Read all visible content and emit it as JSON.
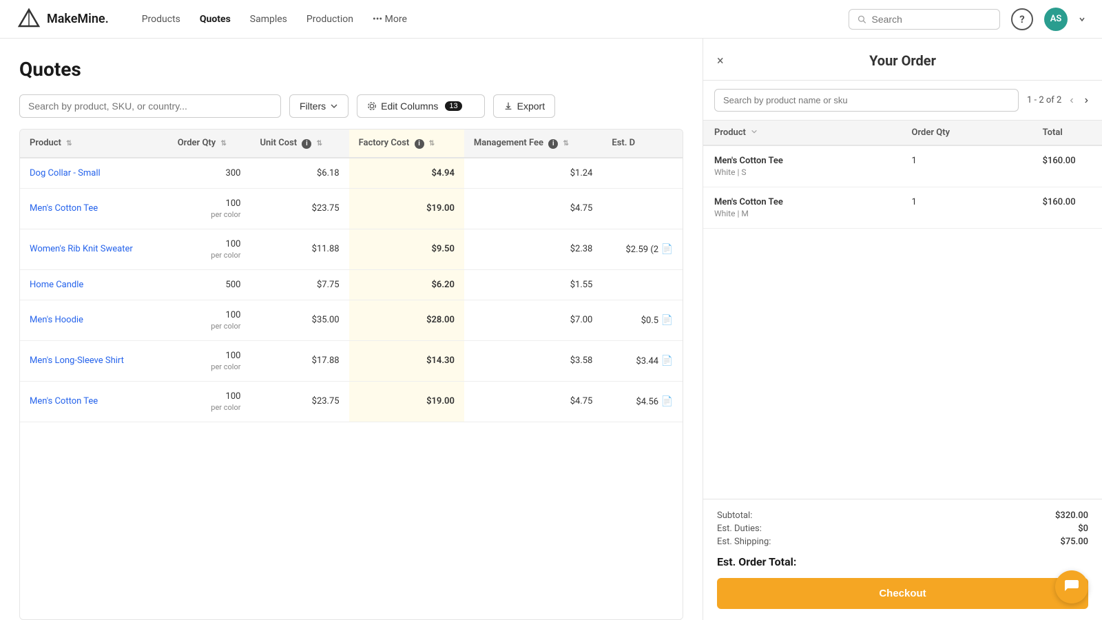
{
  "nav": {
    "logo_text": "MakeMine.",
    "links": [
      {
        "label": "Products",
        "active": false
      },
      {
        "label": "Quotes",
        "active": true
      },
      {
        "label": "Samples",
        "active": false
      },
      {
        "label": "Production",
        "active": false
      },
      {
        "label": "••• More",
        "active": false
      }
    ],
    "search_placeholder": "Search",
    "avatar_initials": "AS"
  },
  "main": {
    "page_title": "Quotes",
    "search_placeholder": "Search by product, SKU, or country...",
    "filters_label": "Filters",
    "edit_columns_label": "Edit Columns",
    "edit_columns_count": "13",
    "export_label": "Export",
    "table": {
      "columns": [
        {
          "label": "Product",
          "key": "product"
        },
        {
          "label": "Order Qty",
          "key": "order_qty"
        },
        {
          "label": "Unit Cost",
          "key": "unit_cost"
        },
        {
          "label": "Factory Cost",
          "key": "factory_cost"
        },
        {
          "label": "Management Fee",
          "key": "mgmt_fee"
        },
        {
          "label": "Est. D",
          "key": "est_d"
        }
      ],
      "rows": [
        {
          "product": "Dog Collar - Small",
          "order_qty": "300",
          "per_color": "",
          "unit_cost": "$6.18",
          "factory_cost": "$4.94",
          "mgmt_fee": "$1.24",
          "est_d": "",
          "has_doc": false
        },
        {
          "product": "Men's Cotton Tee",
          "order_qty": "100",
          "per_color": "per color",
          "unit_cost": "$23.75",
          "factory_cost": "$19.00",
          "mgmt_fee": "$4.75",
          "est_d": "",
          "has_doc": false
        },
        {
          "product": "Women's Rib Knit Sweater",
          "order_qty": "100",
          "per_color": "per color",
          "unit_cost": "$11.88",
          "factory_cost": "$9.50",
          "mgmt_fee": "$2.38",
          "est_d": "$2.59 (2",
          "has_doc": true
        },
        {
          "product": "Home Candle",
          "order_qty": "500",
          "per_color": "",
          "unit_cost": "$7.75",
          "factory_cost": "$6.20",
          "mgmt_fee": "$1.55",
          "est_d": "",
          "has_doc": false
        },
        {
          "product": "Men's Hoodie",
          "order_qty": "100",
          "per_color": "per color",
          "unit_cost": "$35.00",
          "factory_cost": "$28.00",
          "mgmt_fee": "$7.00",
          "est_d": "$0.5",
          "has_doc": true
        },
        {
          "product": "Men's Long-Sleeve Shirt",
          "order_qty": "100",
          "per_color": "per color",
          "unit_cost": "$17.88",
          "factory_cost": "$14.30",
          "mgmt_fee": "$3.58",
          "est_d": "$3.44",
          "has_doc": true
        },
        {
          "product": "Men's Cotton Tee",
          "order_qty": "100",
          "per_color": "per color",
          "unit_cost": "$23.75",
          "factory_cost": "$19.00",
          "mgmt_fee": "$4.75",
          "est_d": "$4.56",
          "has_doc": true
        }
      ]
    }
  },
  "panel": {
    "title": "Your Order",
    "close_label": "×",
    "search_placeholder": "Search by product name or sku",
    "pagination": "1 - 2 of 2",
    "columns": [
      {
        "label": "Product"
      },
      {
        "label": "Order Qty"
      },
      {
        "label": "Total"
      }
    ],
    "order_items": [
      {
        "name": "Men's Cotton Tee",
        "variant": "White | S",
        "qty": "1",
        "total": "$160.00"
      },
      {
        "name": "Men's Cotton Tee",
        "variant": "White | M",
        "qty": "1",
        "total": "$160.00"
      }
    ],
    "summary": {
      "subtotal_label": "Subtotal:",
      "subtotal_value": "$320.00",
      "duties_label": "Est. Duties:",
      "duties_value": "$0",
      "shipping_label": "Est. Shipping:",
      "shipping_value": "$75.00",
      "total_label": "Est. Order Total:",
      "total_value": ""
    },
    "checkout_label": "Checkout"
  }
}
